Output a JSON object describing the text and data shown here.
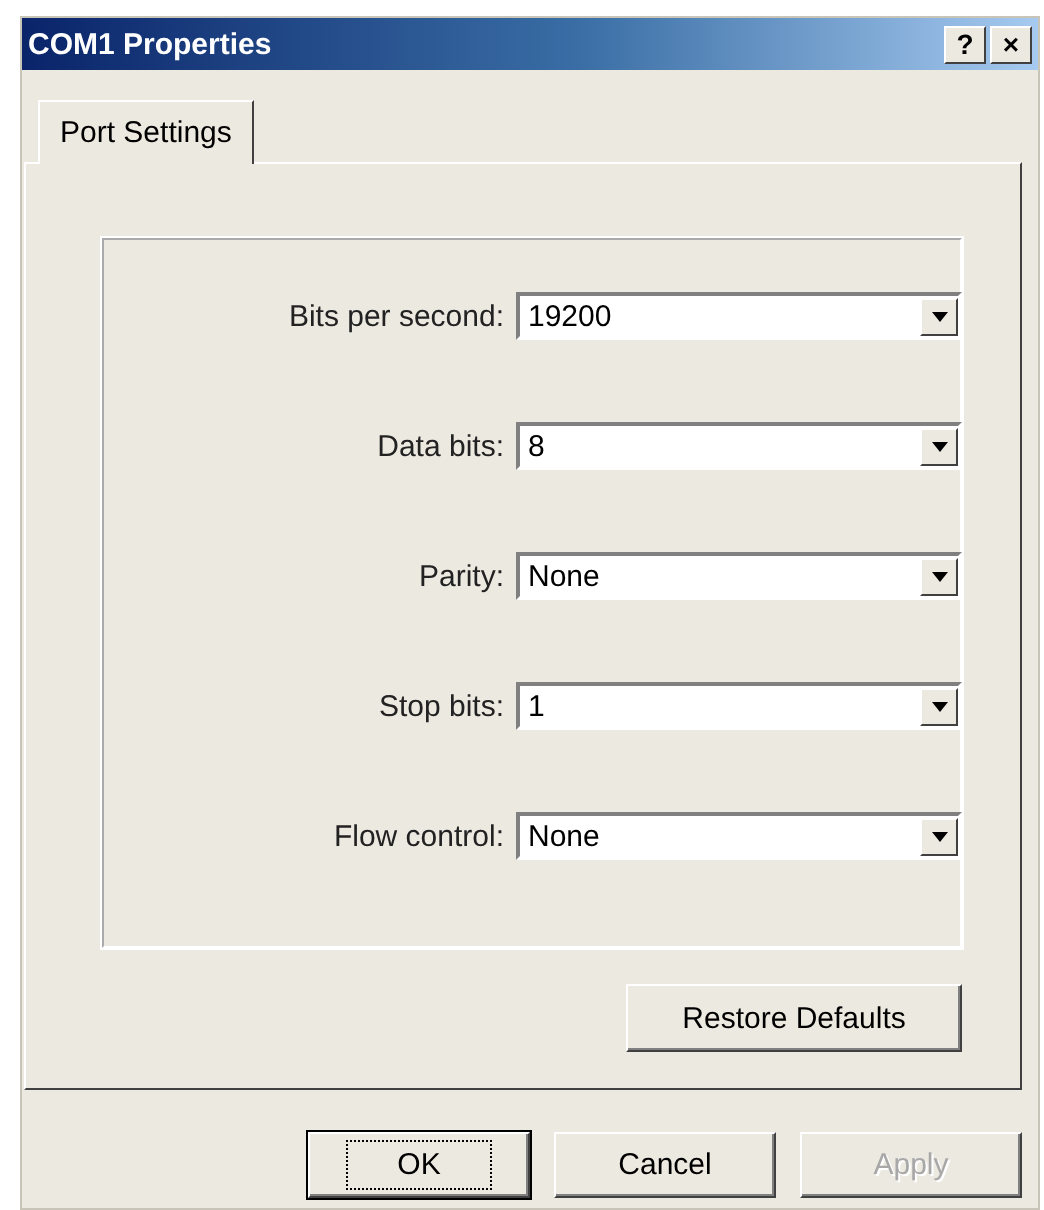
{
  "window": {
    "title": "COM1 Properties",
    "title_buttons": [
      "?",
      "×"
    ]
  },
  "tabs": [
    {
      "label": "Port Settings",
      "selected": true
    }
  ],
  "fields": [
    {
      "label": "Bits per second:",
      "value": "19200"
    },
    {
      "label": "Data bits:",
      "value": "8"
    },
    {
      "label": "Parity:",
      "value": "None"
    },
    {
      "label": "Stop bits:",
      "value": "1"
    },
    {
      "label": "Flow control:",
      "value": "None"
    }
  ],
  "restore_button": {
    "label": "Restore Defaults",
    "disabled": false
  },
  "buttons": [
    {
      "label": "OK",
      "default": true,
      "disabled": false
    },
    {
      "label": "Cancel",
      "default": false,
      "disabled": false
    },
    {
      "label": "Apply",
      "default": false,
      "disabled": true
    }
  ]
}
